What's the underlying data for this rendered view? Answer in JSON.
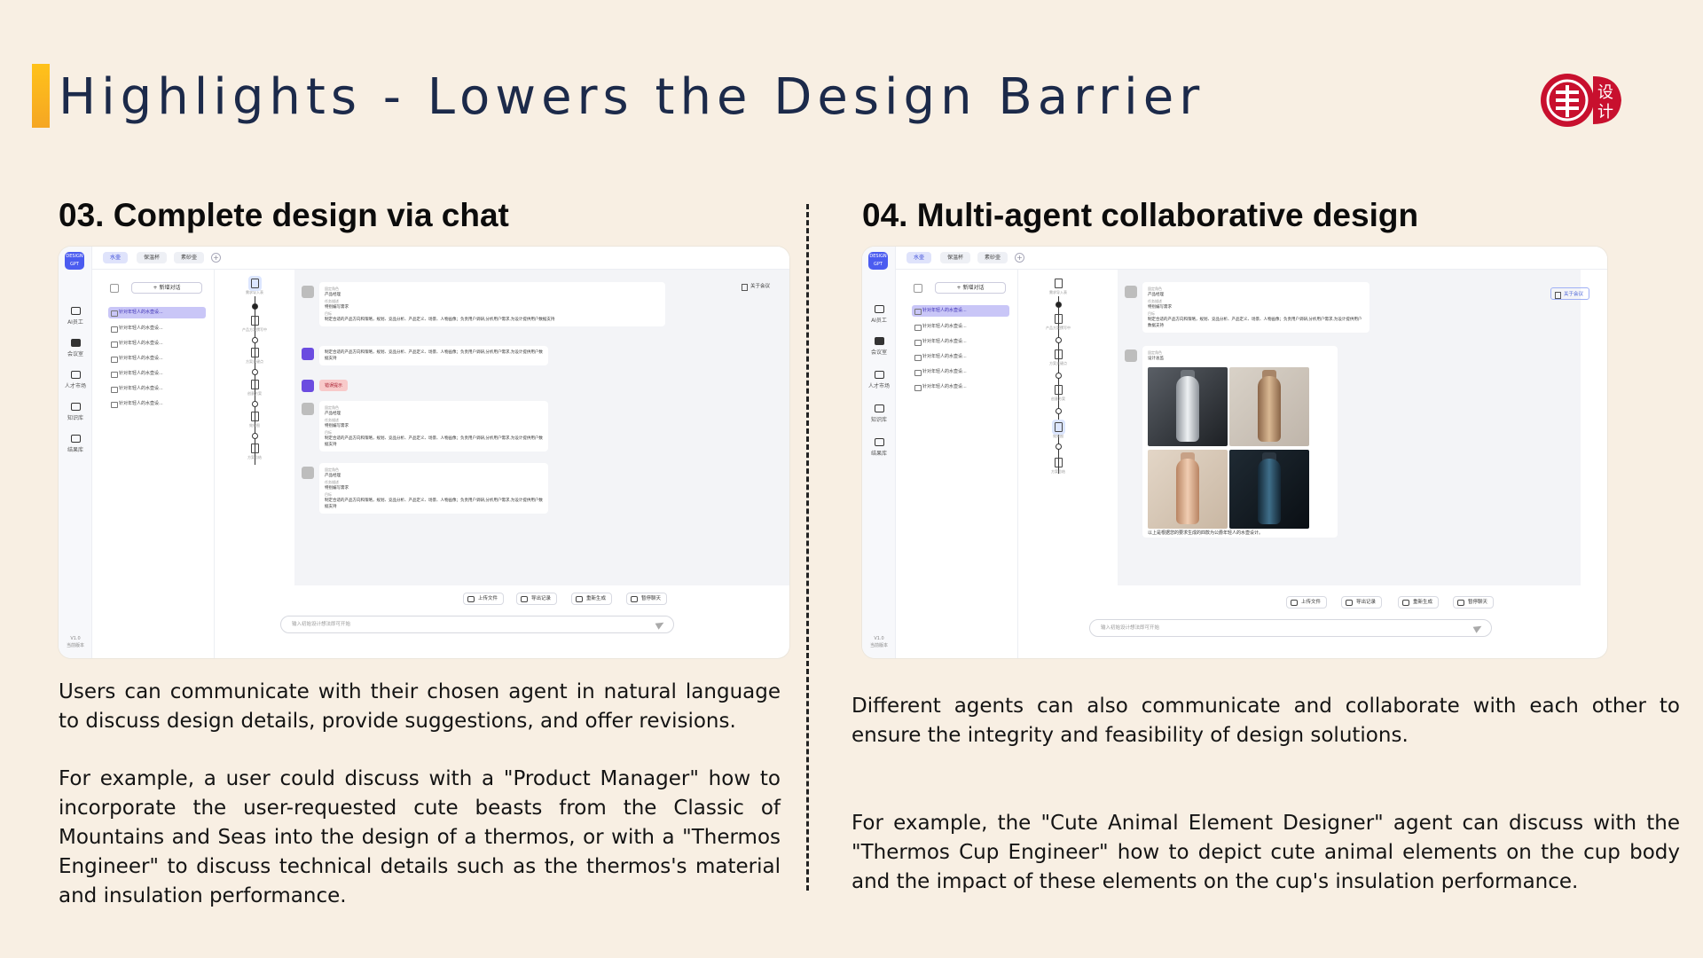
{
  "header": {
    "title": "Highlights - Lowers the Design Barrier",
    "logo_text": [
      "设",
      "计"
    ]
  },
  "sections": [
    {
      "title": "03. Complete design via chat",
      "paragraphs": [
        "Users can communicate with their chosen agent in natural language to discuss design details, provide suggestions, and offer revisions.",
        "For example, a user could discuss with a \"Product Manager\" how to incorporate the user-requested cute beasts from the Classic of Mountains and Seas into the design of a thermos, or with a \"Thermos Engineer\" to discuss technical details such as the thermos's material and insulation performance."
      ]
    },
    {
      "title": "04. Multi-agent collaborative design",
      "paragraphs": [
        "Different agents can also communicate and collaborate with each other to ensure the integrity and feasibility of design solutions.",
        "For example, the \"Cute Animal Element Designer\" agent can discuss with the \"Thermos Cup Engineer\" how to depict cute animal elements on the cup body and the impact of these elements on the cup's insulation performance."
      ]
    }
  ],
  "app": {
    "logo": "DESIGN GPT",
    "tabs": [
      "水壶",
      "保温杯",
      "素砂壶"
    ],
    "rail": [
      "AI员工",
      "会议室",
      "人才市场",
      "知识库",
      "结果库"
    ],
    "version": [
      "V1.0",
      "当前版本"
    ],
    "new_chat": "+ 新增对话",
    "conversation": "针对年轻人的水壶设...",
    "meeting": "关于会议",
    "toolbar": [
      "上传文件",
      "导出记录",
      "重新生成",
      "暂停聊天"
    ],
    "input_placeholder": "输入初始设计想法即可开始",
    "role_label": "固定角色",
    "role_pm": "产品经理",
    "task_label": "任务描述",
    "task_value": "特别编写需求",
    "goal_label": "目标",
    "goal_text": "制定合适的产品方向和策略，规划、竞品分析、产品定义、场景、人物画像；负责用户调研,分析用户需求,为设计提供用户数据支持",
    "bot_text": "制定合适的产品方向和策略，规划、竞品分析、产品定义、场景、人物画像；负责用户调研,分析用户需求,为设计提供用户数据支持",
    "alert": "错误提示",
    "designer_label": "固定角色",
    "designer": "设计总监",
    "image_caption": "以上是根据您的要求生成的四款为公爵年轻人的水壶设计。",
    "flow_nodes": [
      "需求导入表",
      "产品方案撰写中",
      "方案关键点",
      "创意方案",
      "效果图",
      "方案总结"
    ]
  },
  "colors": {
    "background": "#f8efe3",
    "title": "#1c2a4a",
    "accent_bar": "#f5a623",
    "logo_red": "#c8102e",
    "app_primary": "#4b5cf0"
  }
}
